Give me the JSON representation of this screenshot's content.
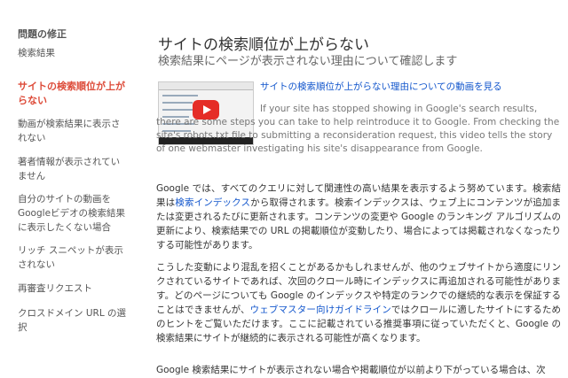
{
  "sidebar": {
    "heading": "問題の修正",
    "items": [
      {
        "label": "検索結果",
        "active": false
      },
      {
        "label": "サイトの検索順位が上がらない",
        "active": true
      },
      {
        "label": "動画が検索結果に表示されない",
        "active": false
      },
      {
        "label": "著者情報が表示されていません",
        "active": false
      },
      {
        "label": "自分のサイトの動画をGoogleビデオの検索結果に表示したくない場合",
        "active": false
      },
      {
        "label": "リッチ スニペットが表示されない",
        "active": false
      },
      {
        "label": "再審査リクエスト",
        "active": false
      },
      {
        "label": "クロスドメイン URL の選択",
        "active": false
      }
    ]
  },
  "main": {
    "title": "サイトの検索順位が上がらない",
    "subtitle": "検索結果にページが表示されない理由について確認します",
    "video": {
      "link": "サイトの検索順位が上がらない理由についての動画を見る",
      "description": "If your site has stopped showing in Google's search results, there are some steps you can take to help reintroduce it to Google. From checking the site's robots.txt file to submitting a reconsideration request, this video tells the story of one webmaster investigating his site's disappearance from Google."
    },
    "para1": {
      "t1": "Google では、すべてのクエリに対して関連性の高い結果を表示するよう努めています。検索結果は",
      "link": "検索インデックス",
      "t2": "から取得されます。検索インデックスは、ウェブ上にコンテンツが追加または変更されるたびに更新されます。コンテンツの変更や Google のランキング アルゴリズムの更新により、検索結果での URL の掲載順位が変動したり、場合によっては掲載されなくなったりする可能性があります。"
    },
    "para2": {
      "t1": "こうした変動により混乱を招くことがあるかもしれませんが、他のウェブサイトから適度にリンクされているサイトであれば、次回のクロール時にインデックスに再追加される可能性があります。どのページについても Google のインデックスや特定のランクでの継続的な表示を保証することはできませんが、",
      "link": "ウェブマスター向けガイドライン",
      "t2": "ではクロールに適したサイトにするためのヒントをご覧いただけます。ここに記載されている推奨事項に従っていただくと、Google の検索結果にサイトが継続的に表示される可能性が高くなります。"
    },
    "para3": "Google 検索結果にサイトが表示されない場合や掲載順位が以前より下がっている場合は、次"
  }
}
